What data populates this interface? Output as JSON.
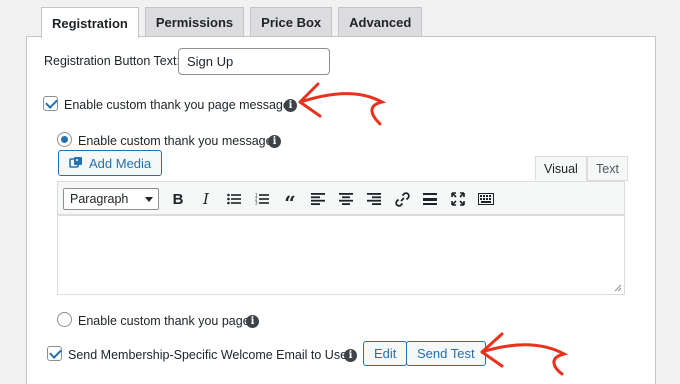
{
  "tabs": [
    {
      "label": "Registration",
      "active": true
    },
    {
      "label": "Permissions",
      "active": false
    },
    {
      "label": "Price Box",
      "active": false
    },
    {
      "label": "Advanced",
      "active": false
    }
  ],
  "registration": {
    "button_text_label": "Registration Button Text:",
    "button_text_value": "Sign Up"
  },
  "thank_you": {
    "enable_message_label": "Enable custom thank you page message",
    "enable_message_checked": true,
    "option_message_label": "Enable custom thank you message",
    "option_page_label": "Enable custom thank you page",
    "selected_option": "message"
  },
  "editor": {
    "add_media_label": "Add Media",
    "tab_visual": "Visual",
    "tab_text": "Text",
    "format_select": "Paragraph",
    "toolbar_icons": [
      "bold-icon",
      "italic-icon",
      "bullet-list-icon",
      "numbered-list-icon",
      "blockquote-icon",
      "align-left-icon",
      "align-center-icon",
      "align-right-icon",
      "link-icon",
      "horizontal-rule-icon",
      "fullscreen-icon",
      "toolbar-toggle-icon"
    ]
  },
  "welcome_email": {
    "label": "Send Membership-Specific Welcome Email to User",
    "checked": true,
    "edit_label": "Edit",
    "send_test_label": "Send Test"
  },
  "colors": {
    "accent": "#2271b1",
    "annotation_arrow": "#e8321d"
  }
}
